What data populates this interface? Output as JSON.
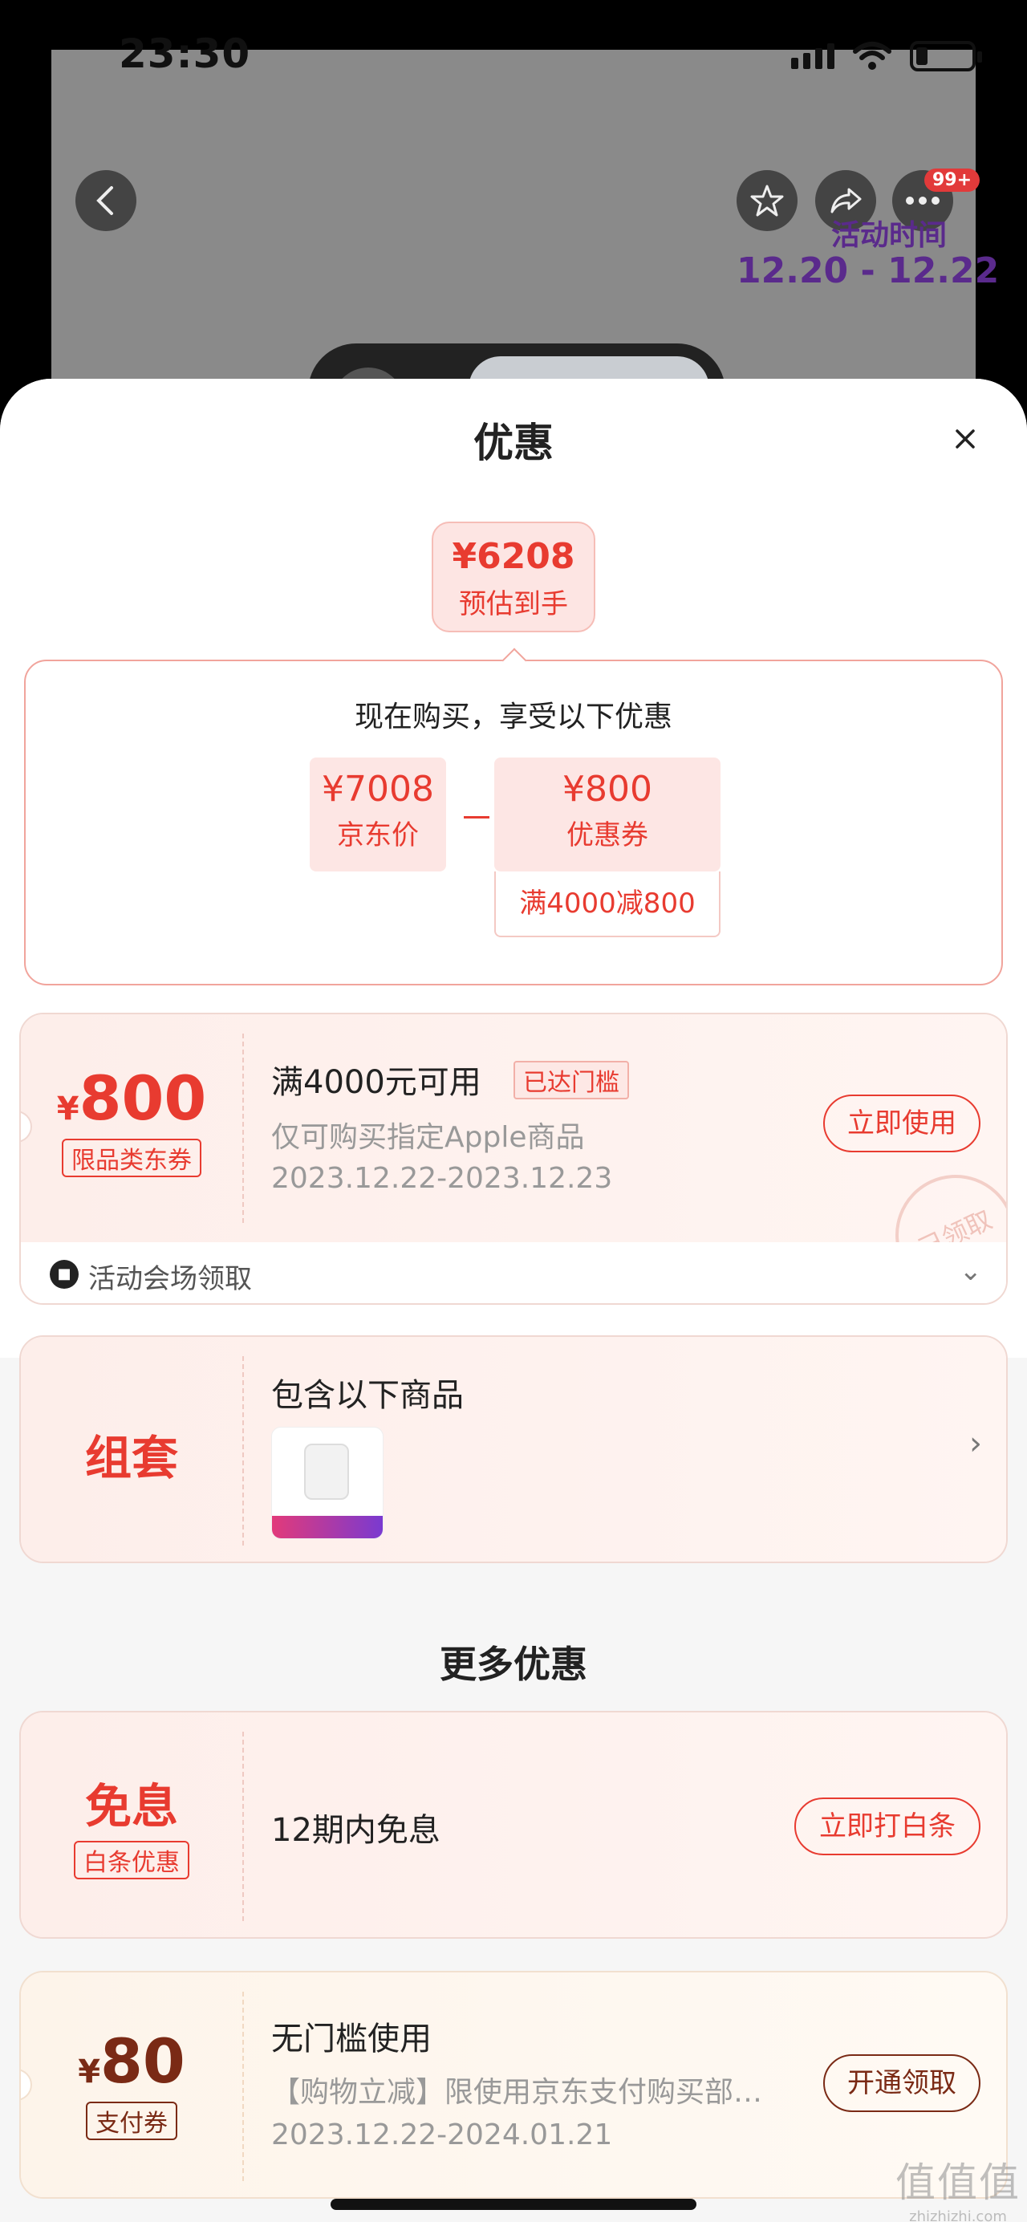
{
  "status_bar": {
    "time": "23:30"
  },
  "background": {
    "activity_label": "活动时间",
    "activity_dates": "12.20 - 12.22",
    "more_badge": "99+"
  },
  "sheet": {
    "title": "优惠",
    "estimate": {
      "price": "¥6208",
      "label": "预估到手"
    },
    "calc": {
      "title": "现在购买，享受以下优惠",
      "jd_price": "¥7008",
      "jd_label": "京东价",
      "minus": "－",
      "coupon_price": "¥800",
      "coupon_label": "优惠券",
      "coupon_condition": "满4000减800"
    },
    "coupon1": {
      "yen": "¥",
      "amount": "800",
      "tag": "限品类东券",
      "main": "满4000元可用",
      "reached": "已达门槛",
      "sub": "仅可购买指定Apple商品",
      "date": "2023.12.22-2023.12.23",
      "button": "立即使用",
      "stamp": "已领取",
      "footer": "活动会场领取"
    },
    "bundle": {
      "left": "组套",
      "title": "包含以下商品"
    },
    "more_title": "更多优惠",
    "baitiao": {
      "left": "免息",
      "tag": "白条优惠",
      "main": "12期内免息",
      "button": "立即打白条"
    },
    "pay_coupon": {
      "yen": "¥",
      "amount": "80",
      "tag": "支付券",
      "main": "无门槛使用",
      "sub": "【购物立减】限使用京东支付购买部分商品",
      "date": "2023.12.22-2024.01.21",
      "button": "开通领取"
    }
  },
  "watermark": {
    "glyphs": "值值值",
    "url": "zhizhizhi.com"
  },
  "colors": {
    "accent": "#e83b30",
    "pay_brown": "#7a2a15"
  }
}
